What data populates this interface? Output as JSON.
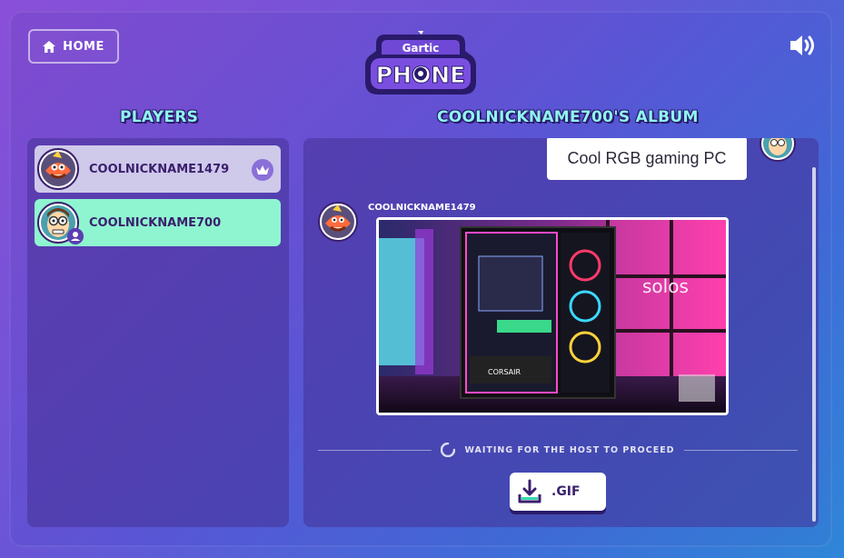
{
  "header": {
    "home_label": "HOME",
    "logo_top": "Gartic",
    "logo_bottom": "PHONE"
  },
  "players": {
    "title": "PLAYERS",
    "list": [
      {
        "name": "COOLNICKNAME1479",
        "is_host": true
      },
      {
        "name": "COOLNICKNAME700",
        "is_host": false
      }
    ]
  },
  "album": {
    "title": "COOLNICKNAME700'S ALBUM",
    "caption": "Cool RGB gaming PC",
    "drawing_author": "COOLNICKNAME1479",
    "waiting_text": "WAITING FOR THE HOST TO PROCEED",
    "gif_label": ".GIF"
  },
  "colors": {
    "accent_cyan": "#8ff3f0",
    "player_highlight": "#8ff5d0",
    "player_default": "#cfc9ea",
    "text_dark": "#3a1f6e"
  }
}
